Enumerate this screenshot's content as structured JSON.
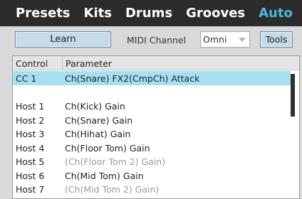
{
  "nav": {
    "tabs": [
      {
        "label": "Presets"
      },
      {
        "label": "Kits"
      },
      {
        "label": "Drums"
      },
      {
        "label": "Grooves"
      },
      {
        "label": "Auto"
      }
    ],
    "active_tab": "Auto"
  },
  "toolbar": {
    "learn_label": "Learn",
    "midi_channel_label": "MIDI Channel",
    "midi_channel_value": "Omni",
    "tools_label": "Tools"
  },
  "table": {
    "headers": {
      "control": "Control",
      "parameter": "Parameter"
    },
    "rows": [
      {
        "control": "CC 1",
        "parameter": "Ch(Snare) FX2(CmpCh) Attack",
        "selected": true,
        "disabled": false
      },
      {
        "control": "",
        "parameter": "",
        "selected": false,
        "disabled": false
      },
      {
        "control": "Host 1",
        "parameter": "Ch(Kick) Gain",
        "selected": false,
        "disabled": false
      },
      {
        "control": "Host 2",
        "parameter": "Ch(Snare) Gain",
        "selected": false,
        "disabled": false
      },
      {
        "control": "Host 3",
        "parameter": "Ch(Hihat) Gain",
        "selected": false,
        "disabled": false
      },
      {
        "control": "Host 4",
        "parameter": "Ch(Floor Tom) Gain",
        "selected": false,
        "disabled": false
      },
      {
        "control": "Host 5",
        "parameter": "(Ch(Floor Tom 2) Gain)",
        "selected": false,
        "disabled": true
      },
      {
        "control": "Host 6",
        "parameter": "Ch(Mid Tom) Gain",
        "selected": false,
        "disabled": false
      },
      {
        "control": "Host 7",
        "parameter": "(Ch(Mid Tom 2) Gain)",
        "selected": false,
        "disabled": true
      }
    ]
  },
  "colors": {
    "nav_bg": "#2b2b2b",
    "active_tab": "#4fb7dc",
    "selected_row": "#a6dff0",
    "button_bg": "#c6dbe8",
    "disabled_text": "#9a9a9a"
  }
}
